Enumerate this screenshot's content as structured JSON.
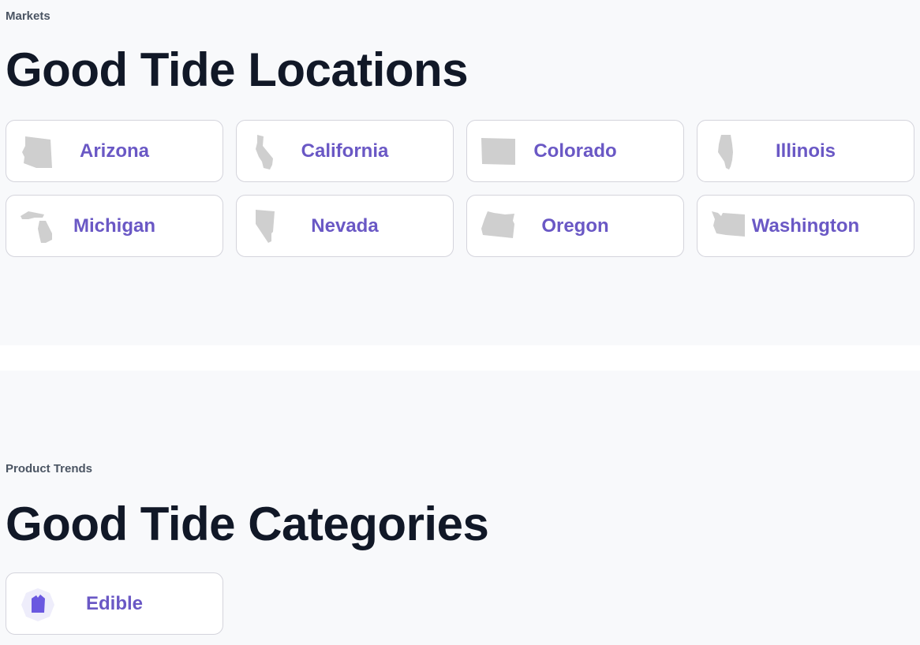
{
  "markets": {
    "eyebrow": "Markets",
    "title": "Good Tide Locations",
    "locations": [
      {
        "label": "Arizona",
        "icon": "arizona-map-icon"
      },
      {
        "label": "California",
        "icon": "california-map-icon"
      },
      {
        "label": "Colorado",
        "icon": "colorado-map-icon"
      },
      {
        "label": "Illinois",
        "icon": "illinois-map-icon"
      },
      {
        "label": "Michigan",
        "icon": "michigan-map-icon"
      },
      {
        "label": "Nevada",
        "icon": "nevada-map-icon"
      },
      {
        "label": "Oregon",
        "icon": "oregon-map-icon"
      },
      {
        "label": "Washington",
        "icon": "washington-map-icon"
      }
    ]
  },
  "trends": {
    "eyebrow": "Product Trends",
    "title": "Good Tide Categories",
    "categories": [
      {
        "label": "Edible",
        "icon": "edible-gummy-icon"
      }
    ]
  },
  "colors": {
    "accent": "#6a58c5",
    "heading": "#111827",
    "eyebrow": "#4b5563",
    "map_fill": "#cfcfcf",
    "card_border": "#d4d4dc",
    "background": "#f8f9fb"
  }
}
